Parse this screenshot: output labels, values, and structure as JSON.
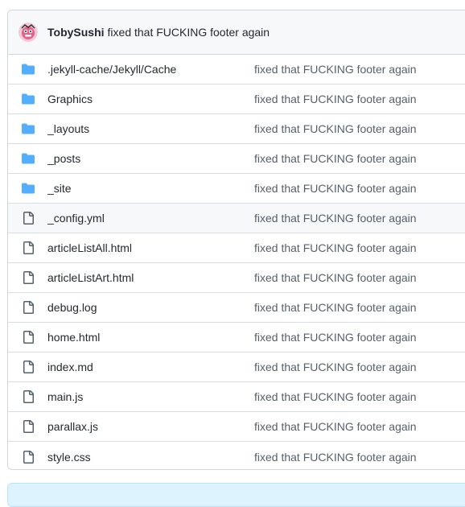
{
  "commit": {
    "author": "TobySushi",
    "message": "fixed that FUCKING footer again"
  },
  "colors": {
    "folder": "#54aeff",
    "file": "#57606a",
    "border": "#d0d7de",
    "header_bg": "#f6f8fa"
  },
  "files": [
    {
      "name": ".jekyll-cache/Jekyll/Cache",
      "type": "folder",
      "icon": "folder-icon",
      "commit": "fixed that FUCKING footer again"
    },
    {
      "name": "Graphics",
      "type": "folder",
      "icon": "folder-icon",
      "commit": "fixed that FUCKING footer again"
    },
    {
      "name": "_layouts",
      "type": "folder",
      "icon": "folder-icon",
      "commit": "fixed that FUCKING footer again"
    },
    {
      "name": "_posts",
      "type": "folder",
      "icon": "folder-icon",
      "commit": "fixed that FUCKING footer again"
    },
    {
      "name": "_site",
      "type": "folder",
      "icon": "folder-icon",
      "commit": "fixed that FUCKING footer again"
    },
    {
      "name": "_config.yml",
      "type": "file",
      "icon": "file-icon",
      "commit": "fixed that FUCKING footer again"
    },
    {
      "name": "articleListAll.html",
      "type": "file",
      "icon": "file-icon",
      "commit": "fixed that FUCKING footer again"
    },
    {
      "name": "articleListArt.html",
      "type": "file",
      "icon": "file-icon",
      "commit": "fixed that FUCKING footer again"
    },
    {
      "name": "debug.log",
      "type": "file",
      "icon": "file-icon",
      "commit": "fixed that FUCKING footer again"
    },
    {
      "name": "home.html",
      "type": "file",
      "icon": "file-icon",
      "commit": "fixed that FUCKING footer again"
    },
    {
      "name": "index.md",
      "type": "file",
      "icon": "file-icon",
      "commit": "fixed that FUCKING footer again"
    },
    {
      "name": "main.js",
      "type": "file",
      "icon": "file-icon",
      "commit": "fixed that FUCKING footer again"
    },
    {
      "name": "parallax.js",
      "type": "file",
      "icon": "file-icon",
      "commit": "fixed that FUCKING footer again"
    },
    {
      "name": "style.css",
      "type": "file",
      "icon": "file-icon",
      "commit": "fixed that FUCKING footer again"
    }
  ]
}
